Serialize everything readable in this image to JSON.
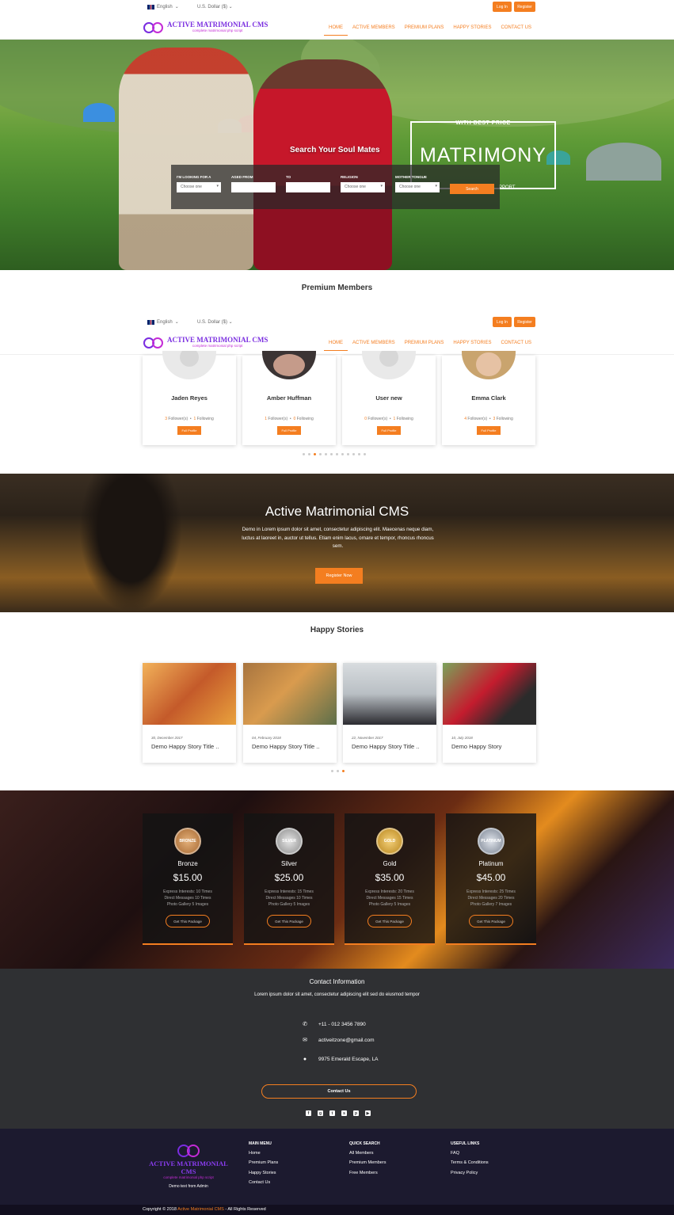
{
  "topbar": {
    "language": "English",
    "currency": "U.S. Dollar ($)",
    "login_label": "Log In",
    "register_label": "Register"
  },
  "brand": {
    "name": "ACTIVE MATRIMONIAL CMS",
    "tagline": "complete matrimonial php script"
  },
  "nav": {
    "items": [
      {
        "label": "HOME",
        "active": true
      },
      {
        "label": "ACTIVE MEMBERS",
        "active": false
      },
      {
        "label": "PREMIUM PLANS",
        "active": false
      },
      {
        "label": "HAPPY STORIES",
        "active": false
      },
      {
        "label": "CONTACT US",
        "active": false
      }
    ]
  },
  "hero": {
    "search_title": "Search Your Soul Mates",
    "fields": [
      {
        "label": "I'M LOOKING FOR A",
        "value": "Choose one"
      },
      {
        "label": "AGED FROM",
        "value": ""
      },
      {
        "label": "TO",
        "value": ""
      },
      {
        "label": "RELIGION",
        "value": "Choose one"
      },
      {
        "label": "MOTHER TONGUE",
        "value": "Choose one"
      }
    ],
    "search_button": "Search",
    "promo_top": "WITH BEST PRICE",
    "promo_main": "MATRIMONY",
    "promo_bottom": "PPORT"
  },
  "premium": {
    "title": "Premium Members",
    "members": [
      {
        "name": "Jaden Reyes",
        "followers": "3",
        "following": "1"
      },
      {
        "name": "Amber Huffman",
        "followers": "1",
        "following": "0"
      },
      {
        "name": "User new",
        "followers": "0",
        "following": "1"
      },
      {
        "name": "Emma Clark",
        "followers": "4",
        "following": "3"
      }
    ],
    "followers_label": "Follower(s)",
    "following_label": "Following",
    "button_label": "Full Profile"
  },
  "about": {
    "title": "Active Matrimonial CMS",
    "text": "Demo in Lorem ipsum dolor sit amet, consectetur adipiscing elit. Maecenas neque diam, luctus at laoreet in, auctor ut tellus. Etiam enim lacus, ornare et tempor, rhoncus rhoncus sem.",
    "button": "Register Now"
  },
  "stories": {
    "title": "Happy Stories",
    "items": [
      {
        "date": "30, December 2017",
        "title": "Demo Happy Story Title .."
      },
      {
        "date": "04, February 2018",
        "title": "Demo Happy Story Title .."
      },
      {
        "date": "22, November 2017",
        "title": "Demo Happy Story Title .."
      },
      {
        "date": "10, July 2018",
        "title": "Demo Happy Story"
      }
    ]
  },
  "plans": {
    "button_label": "Get This Package",
    "items": [
      {
        "medal": "BRONZE",
        "name": "Bronze",
        "price": "$15.00",
        "interests": "Express Interests: 10 Times",
        "messages": "Direct Messages 10 Times",
        "gallery": "Photo Gallery 5 Images",
        "color": "#c98a4a"
      },
      {
        "medal": "SILVER",
        "name": "Silver",
        "price": "$25.00",
        "interests": "Express Interests: 15 Times",
        "messages": "Direct Messages 10 Times",
        "gallery": "Photo Gallery 5 Images",
        "color": "#9a9a9a"
      },
      {
        "medal": "GOLD",
        "name": "Gold",
        "price": "$35.00",
        "interests": "Express Interests: 20 Times",
        "messages": "Direct Messages 15 Times",
        "gallery": "Photo Gallery 5 Images",
        "color": "#c99a2c"
      },
      {
        "medal": "PLATINUM",
        "name": "Platinum",
        "price": "$45.00",
        "interests": "Express Interests: 25 Times",
        "messages": "Direct Messages 20 Times",
        "gallery": "Photo Gallery 7 Images",
        "color": "#8a93a0"
      }
    ]
  },
  "contact": {
    "title": "Contact Information",
    "subtitle": "Lorem ipsum dolor sit amet, consectetur adipiscing elit sed do eiusmod tempor",
    "phone": "+11 - 012 3456 7890",
    "email": "activeitzone@gmail.com",
    "address": "9975 Emerald Escape, LA",
    "button": "Contact Us"
  },
  "footer": {
    "demo_text": "Demo text from Admin",
    "main_menu": {
      "title": "MAIN MENU",
      "links": [
        "Home",
        "Premium Plans",
        "Happy Stories",
        "Contact Us"
      ]
    },
    "quick_search": {
      "title": "QUICK SEARCH",
      "links": [
        "All Members",
        "Premium Members",
        "Free Members"
      ]
    },
    "useful_links": {
      "title": "USEFUL LINKS",
      "links": [
        "FAQ",
        "Terms & Conditions",
        "Privacy Policy"
      ]
    },
    "copyright_pre": "Copyright © 2018",
    "copyright_brand": "Active Matrimonial CMS",
    "copyright_post": "- All Rights Reserved"
  },
  "colors": {
    "accent": "#f47e20",
    "brand_purple": "#7b2fe0"
  }
}
